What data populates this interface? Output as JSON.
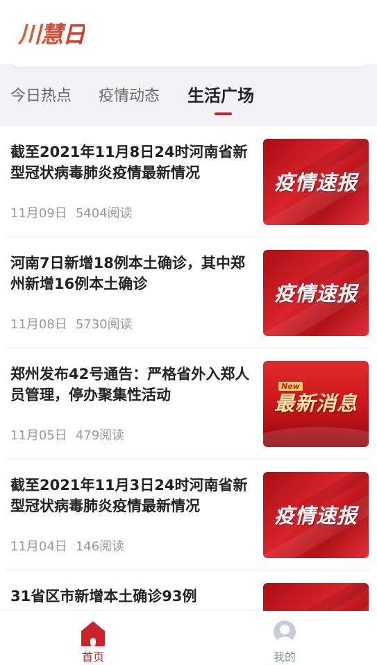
{
  "app": {
    "logo_text": "川慧日"
  },
  "tabs": [
    {
      "label": "今日热点",
      "active": false
    },
    {
      "label": "疫情动态",
      "active": false
    },
    {
      "label": "生活广场",
      "active": true
    }
  ],
  "articles": [
    {
      "title": "截至2021年11月8日24时河南省新型冠状病毒肺炎疫情最新情况",
      "date": "11月09日",
      "reads": "5404阅读",
      "thumb_text": "疫情速报",
      "thumb_style": "report"
    },
    {
      "title": "河南7日新增18例本土确诊，其中郑州新增16例本土确诊",
      "date": "11月08日",
      "reads": "5730阅读",
      "thumb_text": "疫情速报",
      "thumb_style": "report"
    },
    {
      "title": "郑州发布42号通告：严格省外入郑人员管理，停办聚集性活动",
      "date": "11月05日",
      "reads": "479阅读",
      "thumb_text": "最新消息",
      "thumb_badge": "New",
      "thumb_style": "news"
    },
    {
      "title": "截至2021年11月3日24时河南省新型冠状病毒肺炎疫情最新情况",
      "date": "11月04日",
      "reads": "146阅读",
      "thumb_text": "疫情速报",
      "thumb_style": "report"
    },
    {
      "title": "31省区市新增本土确诊93例",
      "date": "",
      "reads": "",
      "thumb_text": "",
      "thumb_style": "report"
    }
  ],
  "bottom_nav": [
    {
      "label": "首页",
      "icon": "home-icon",
      "active": true
    },
    {
      "label": "我的",
      "icon": "profile-icon",
      "active": false
    }
  ],
  "colors": {
    "accent": "#c8242a",
    "inactive": "#8a93a6"
  }
}
